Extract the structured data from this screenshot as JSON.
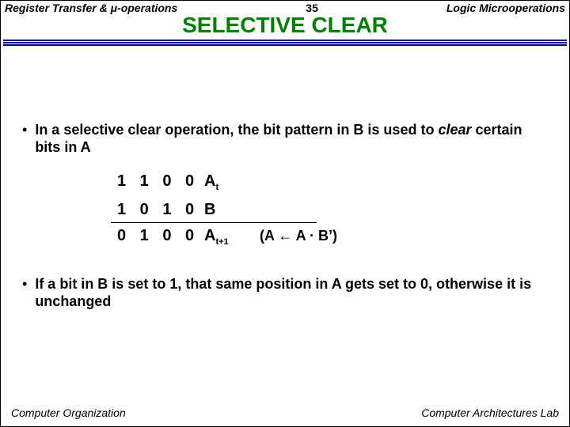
{
  "header": {
    "left_a": "Register Transfer & ",
    "mu": "μ",
    "left_b": "-operations",
    "center": "35",
    "right": "Logic Microoperations"
  },
  "title": "SELECTIVE CLEAR",
  "bullet1_a": "In a selective clear operation, the bit pattern in B is used to ",
  "bullet1_b": "clear",
  "bullet1_c": " certain bits in A",
  "rows": {
    "r1_bits": "1 1 0 0",
    "r1_lab": "A",
    "r1_sub": "t",
    "r2_bits": "1 0 1 0",
    "r2_lab": "B",
    "r3_bits": "0 1 0 0",
    "r3_lab": "A",
    "r3_sub": "t+1",
    "expr": "(A ← A · B’)"
  },
  "bullet2": "If a bit in B is set to 1, that same position in A gets set to 0, otherwise it is unchanged",
  "footer": {
    "left": "Computer Organization",
    "right": "Computer Architectures Lab"
  }
}
